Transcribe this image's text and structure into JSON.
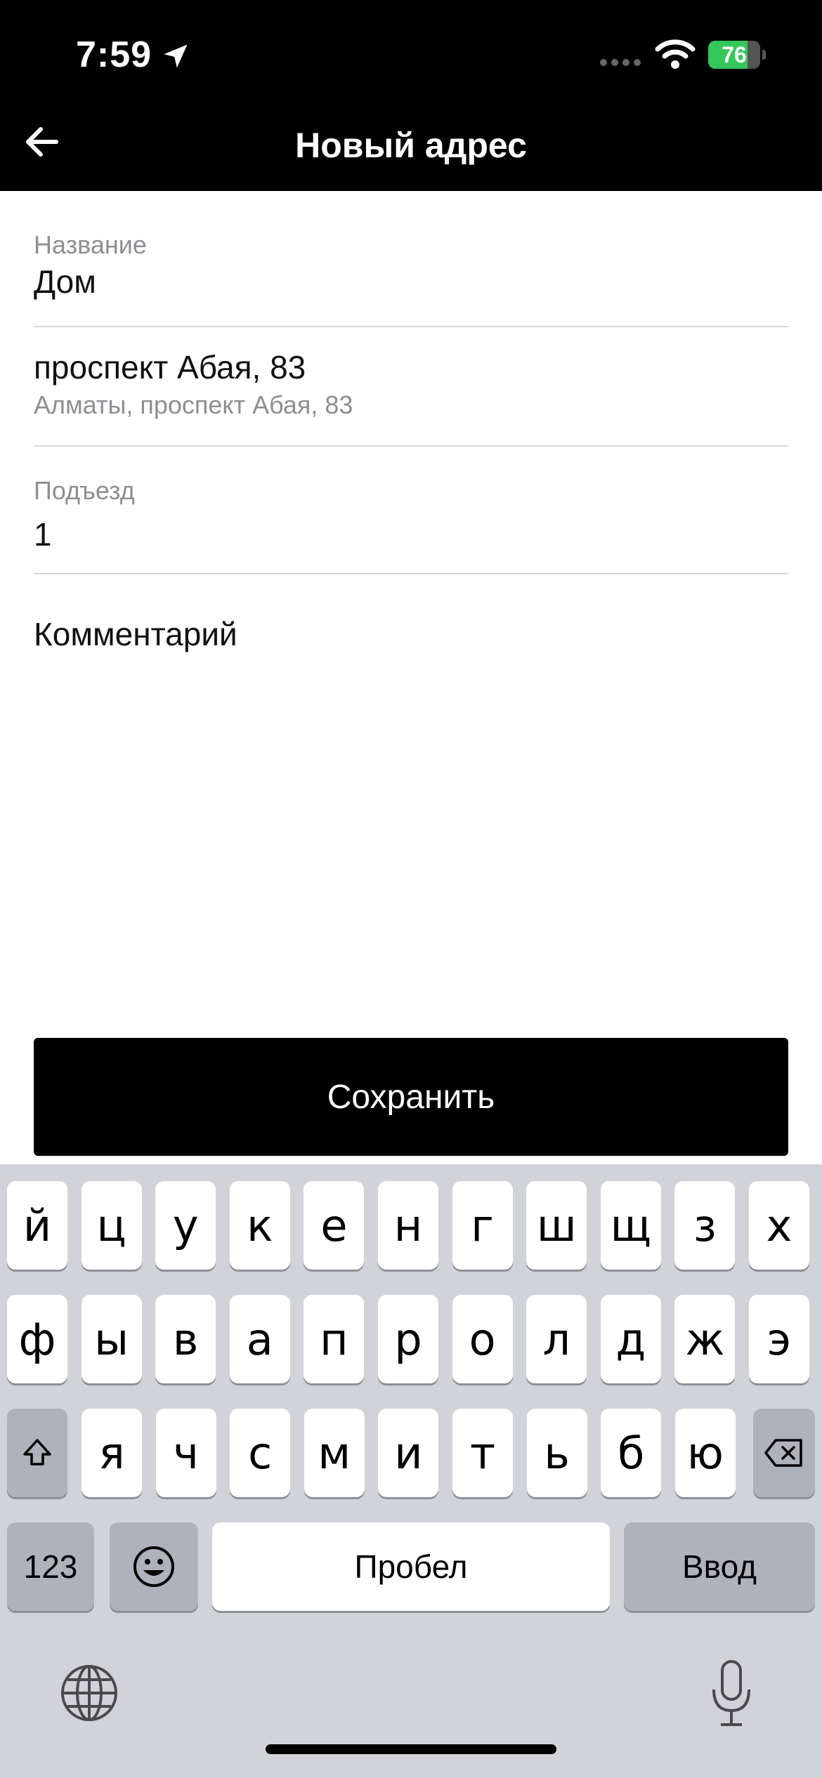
{
  "status_bar": {
    "time": "7:59",
    "battery": "76",
    "battery_level": 0.76
  },
  "header": {
    "title": "Новый адрес"
  },
  "form": {
    "name_label": "Название",
    "name_value": "Дом",
    "address_main": "проспект Абая, 83",
    "address_sub": "Алматы, проспект Абая, 83",
    "entrance_label": "Подъезд",
    "entrance_value": "1",
    "comment_label": "Комментарий"
  },
  "save_label": "Сохранить",
  "keyboard": {
    "row1": [
      "й",
      "ц",
      "у",
      "к",
      "е",
      "н",
      "г",
      "ш",
      "щ",
      "з",
      "х"
    ],
    "row2": [
      "ф",
      "ы",
      "в",
      "а",
      "п",
      "р",
      "о",
      "л",
      "д",
      "ж",
      "э"
    ],
    "row3": [
      "я",
      "ч",
      "с",
      "м",
      "и",
      "т",
      "ь",
      "б",
      "ю"
    ],
    "numbers_label": "123",
    "space_label": "Пробел",
    "return_label": "Ввод",
    "icons": [
      "shift-icon",
      "backspace-icon",
      "emoji-icon",
      "globe-icon",
      "microphone-icon",
      "location-arrow-icon",
      "wifi-icon",
      "back-arrow-icon"
    ]
  },
  "colors": {
    "header_bg": "#000000",
    "button_bg": "#000000",
    "battery_green": "#35c759",
    "keyboard_bg": "#d1d3d9"
  }
}
